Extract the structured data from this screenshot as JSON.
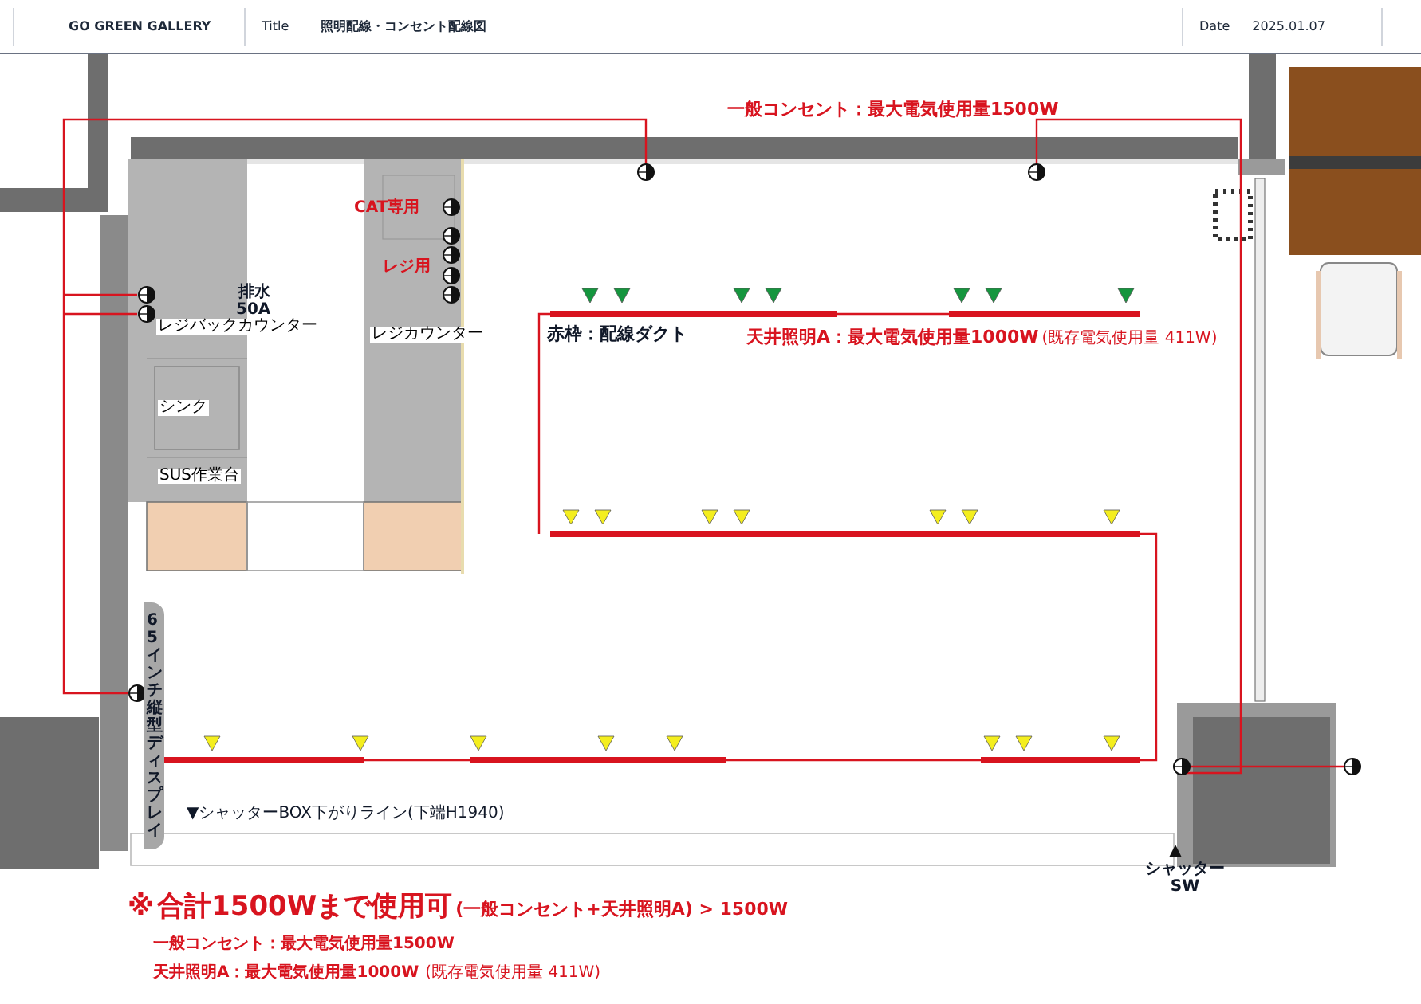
{
  "header": {
    "company": "GO GREEN GALLERY",
    "title_label": "Title",
    "title": "照明配線・コンセント配線図",
    "date_label": "Date",
    "date": "2025.01.07"
  },
  "plan": {
    "outlet_note": "一般コンセント：最大電気使用量1500W",
    "cat_label": "CAT専用",
    "register_label": "レジ用",
    "drain_label": [
      "排水",
      "50A"
    ],
    "back_counter": "レジバックカウンター",
    "register_counter": "レジカウンター",
    "sink": "シンク",
    "work_table": "SUS作業台",
    "duct_legend": "赤枠：配線ダクト",
    "lighting_note": "天井照明A：最大電気使用量1000W",
    "lighting_existing": "(既存電気使用量 411W)",
    "display_label": "65インチ縦型ディスプレイ",
    "shutter_line": "▼シャッターBOX下がりライン(下端H1940)",
    "shutter_switch": [
      "シャッター",
      "SW"
    ],
    "light_rows": [
      {
        "color": "#15963e"
      },
      {
        "color": "#f4ee1e"
      },
      {
        "color": "#f4ee1e"
      }
    ]
  },
  "footer": {
    "mark": "※",
    "headline": "合計1500Wまで使用可",
    "headline_sub": "(一般コンセント+天井照明A) > 1500W",
    "lines": [
      "一般コンセント：最大電気使用量1500W",
      "天井照明A：最大電気使用量1000W"
    ],
    "lines_sub": "(既存電気使用量 411W)"
  }
}
